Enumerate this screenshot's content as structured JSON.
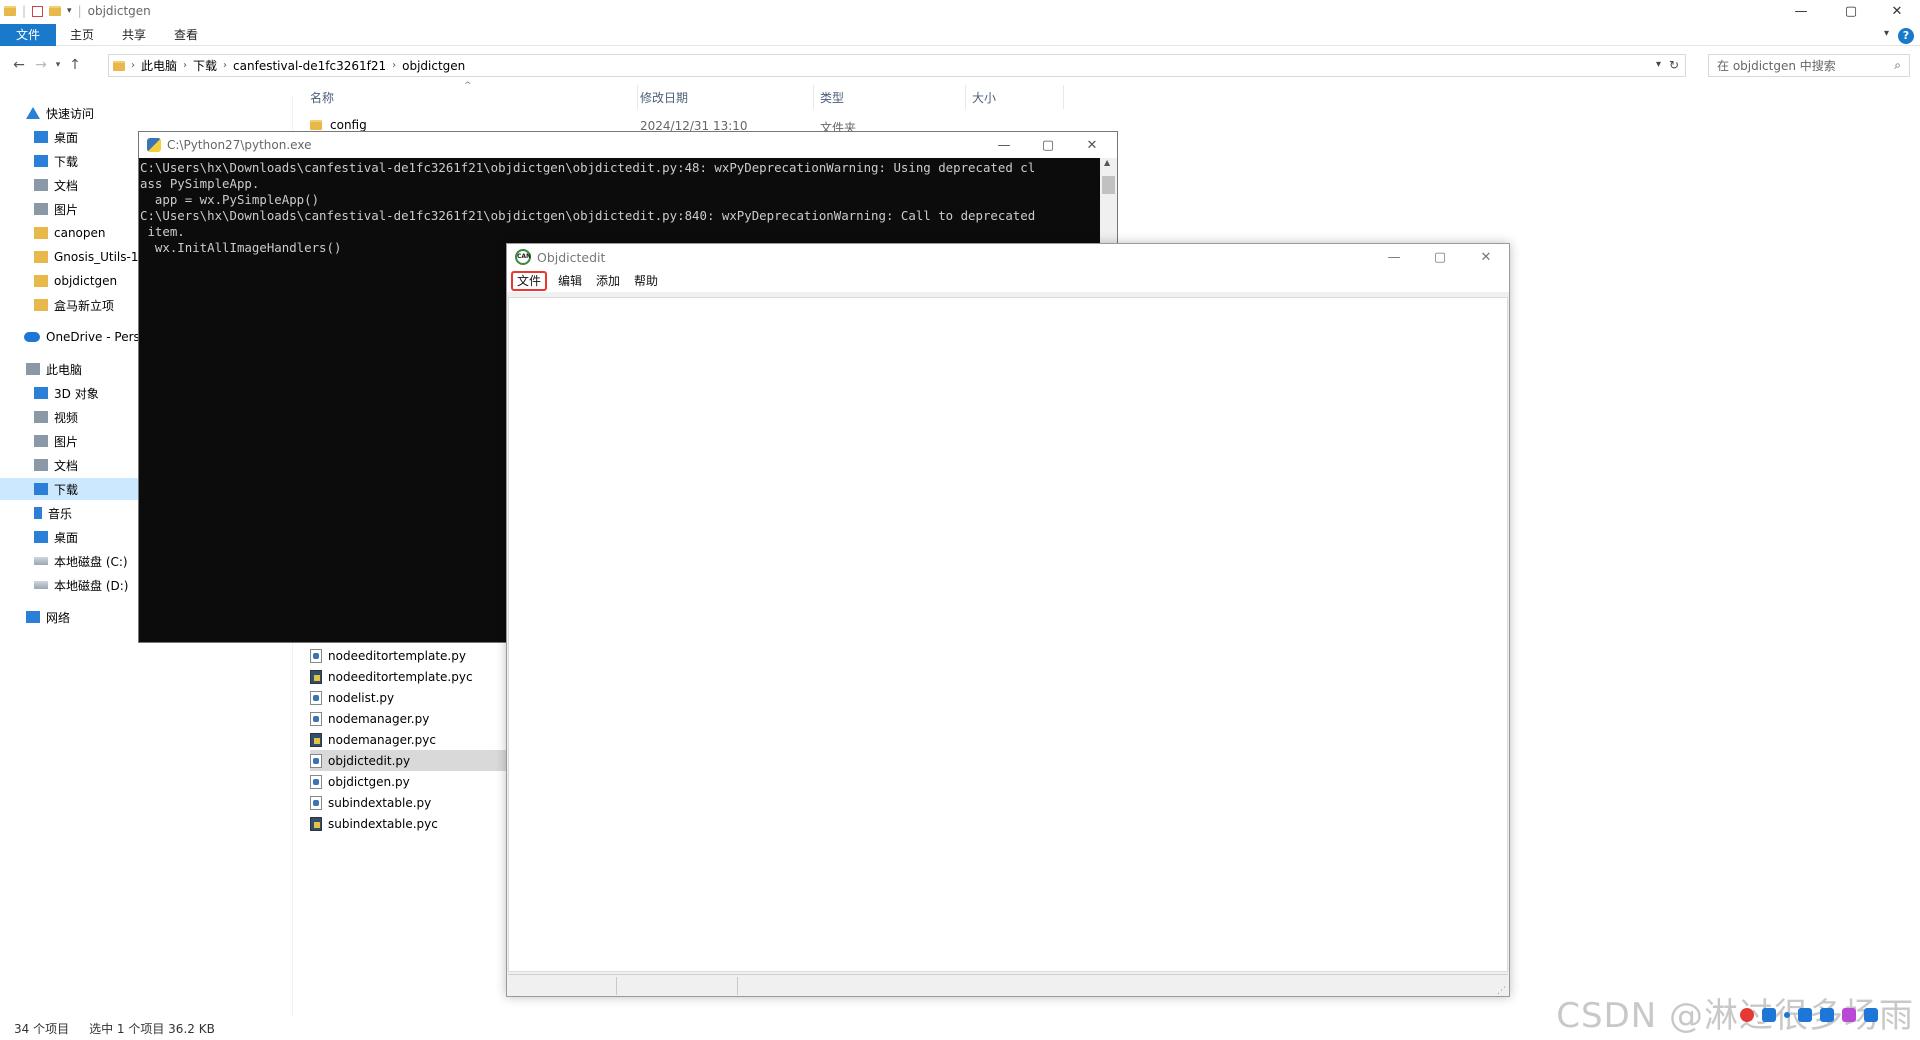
{
  "explorer": {
    "title": "objdictgen",
    "window_controls": [
      "—",
      "▢",
      "✕"
    ],
    "ribbon_tabs": [
      "文件",
      "主页",
      "共享",
      "查看"
    ],
    "breadcrumb": [
      "此电脑",
      "下载",
      "canfestival-de1fc3261f21",
      "objdictgen"
    ],
    "search_placeholder": "在 objdictgen 中搜索",
    "columns": {
      "name": "名称",
      "date": "修改日期",
      "type": "类型",
      "size": "大小"
    },
    "first_row": {
      "name": "config",
      "date": "2024/12/31 13:10",
      "type": "文件夹"
    },
    "files": [
      {
        "name": "nodeeditortemplate.py",
        "kind": "py"
      },
      {
        "name": "nodeeditortemplate.pyc",
        "kind": "pyc"
      },
      {
        "name": "nodelist.py",
        "kind": "py"
      },
      {
        "name": "nodemanager.py",
        "kind": "py"
      },
      {
        "name": "nodemanager.pyc",
        "kind": "pyc"
      },
      {
        "name": "objdictedit.py",
        "kind": "py",
        "selected": true
      },
      {
        "name": "objdictgen.py",
        "kind": "py"
      },
      {
        "name": "subindextable.py",
        "kind": "py"
      },
      {
        "name": "subindextable.pyc",
        "kind": "pyc"
      }
    ],
    "sidebar": {
      "quick_access": "快速访问",
      "quick_items": [
        "桌面",
        "下载",
        "文档",
        "图片",
        "canopen",
        "Gnosis_Utils-1.",
        "objdictgen",
        "盒马新立项"
      ],
      "onedrive": "OneDrive - Pers",
      "this_pc": "此电脑",
      "pc_items": [
        "3D 对象",
        "视频",
        "图片",
        "文档",
        "下载",
        "音乐",
        "桌面",
        "本地磁盘 (C:)",
        "本地磁盘 (D:)"
      ],
      "network": "网络"
    },
    "status": {
      "count": "34 个项目",
      "selected": "选中 1 个项目  36.2 KB"
    }
  },
  "console": {
    "title": "C:\\Python27\\python.exe",
    "output": "C:\\Users\\hx\\Downloads\\canfestival-de1fc3261f21\\objdictgen\\objdictedit.py:48: wxPyDeprecationWarning: Using deprecated cl\nass PySimpleApp.\n  app = wx.PySimpleApp()\nC:\\Users\\hx\\Downloads\\canfestival-de1fc3261f21\\objdictgen\\objdictedit.py:840: wxPyDeprecationWarning: Call to deprecated\n item.\n  wx.InitAllImageHandlers()"
  },
  "objdictedit": {
    "title": "Objdictedit",
    "icon_text": "CAN",
    "menu": [
      "文件",
      "编辑",
      "添加",
      "帮助"
    ]
  },
  "watermark": "CSDN @淋过很多场雨"
}
